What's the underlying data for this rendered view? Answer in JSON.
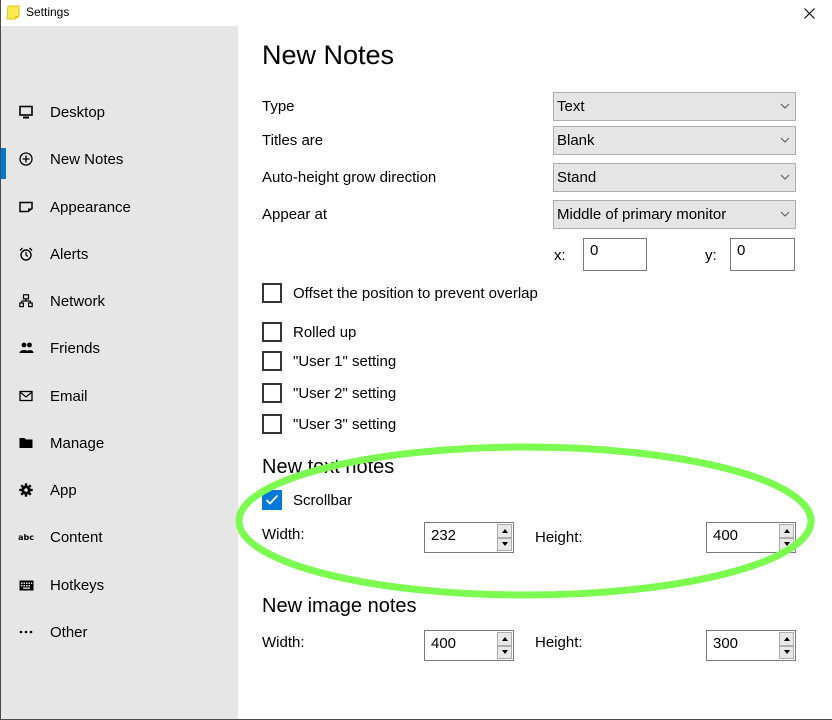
{
  "window": {
    "title": "Settings",
    "close_icon": "close-icon"
  },
  "sidebar": {
    "active_index": 1,
    "accent_color": "#0078d7",
    "items": [
      {
        "label": "Desktop",
        "icon": "monitor-icon"
      },
      {
        "label": "New Notes",
        "icon": "plus-circle-icon"
      },
      {
        "label": "Appearance",
        "icon": "note-icon"
      },
      {
        "label": "Alerts",
        "icon": "alarm-clock-icon"
      },
      {
        "label": "Network",
        "icon": "network-icon"
      },
      {
        "label": "Friends",
        "icon": "people-icon"
      },
      {
        "label": "Email",
        "icon": "envelope-icon"
      },
      {
        "label": "Manage",
        "icon": "folder-icon"
      },
      {
        "label": "App",
        "icon": "gear-icon"
      },
      {
        "label": "Content",
        "icon": "abc-icon"
      },
      {
        "label": "Hotkeys",
        "icon": "keyboard-icon"
      },
      {
        "label": "Other",
        "icon": "ellipsis-icon"
      }
    ]
  },
  "main": {
    "title": "New Notes",
    "fields": {
      "type": {
        "label": "Type",
        "value": "Text"
      },
      "titles": {
        "label": "Titles are",
        "value": "Blank"
      },
      "grow": {
        "label": "Auto-height grow direction",
        "value": "Stand"
      },
      "appear": {
        "label": "Appear at",
        "value": "Middle of primary monitor"
      }
    },
    "position": {
      "x_label": "x:",
      "x_value": "0",
      "y_label": "y:",
      "y_value": "0"
    },
    "checkboxes": {
      "offset": {
        "label": "Offset the position to prevent overlap",
        "checked": false
      },
      "rolled": {
        "label": "Rolled up",
        "checked": false
      },
      "user1": {
        "label": "\"User 1\" setting",
        "checked": false
      },
      "user2": {
        "label": "\"User 2\" setting",
        "checked": false
      },
      "user3": {
        "label": "\"User 3\" setting",
        "checked": false
      }
    },
    "text_notes": {
      "title": "New text notes",
      "scrollbar": {
        "label": "Scrollbar",
        "checked": true
      },
      "width_label": "Width:",
      "width_value": "232",
      "height_label": "Height:",
      "height_value": "400"
    },
    "image_notes": {
      "title": "New image notes",
      "width_label": "Width:",
      "width_value": "400",
      "height_label": "Height:",
      "height_value": "300"
    }
  },
  "annotation": {
    "highlight_color": "#7cfc50"
  }
}
